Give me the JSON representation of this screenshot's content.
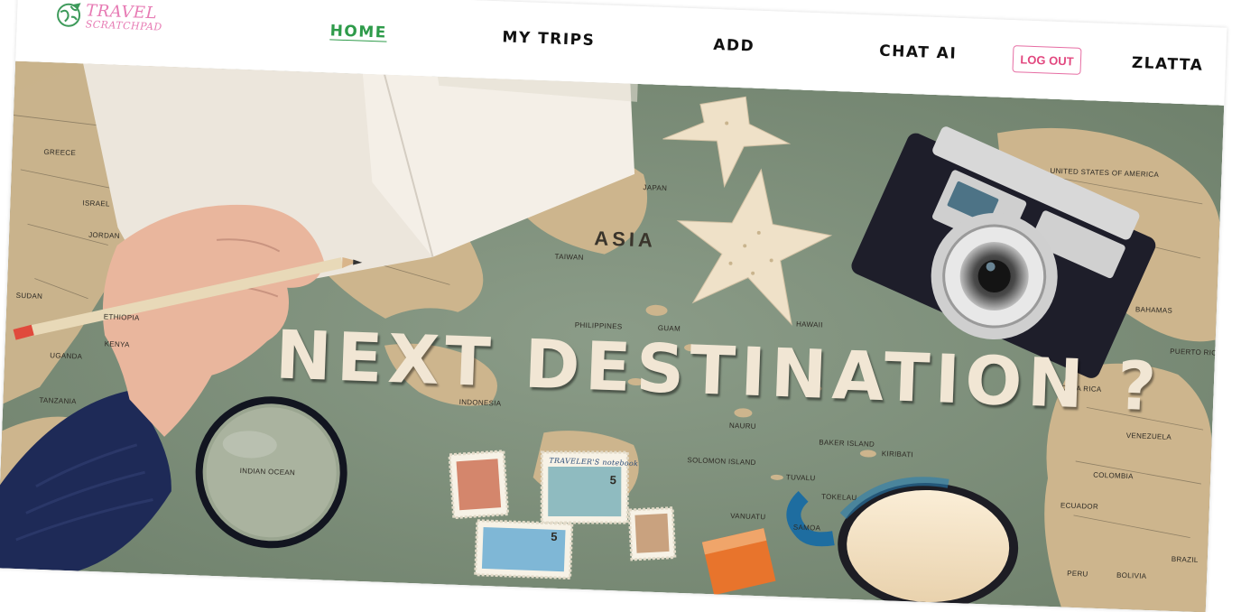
{
  "brand": {
    "logo_line1": "TRAVEL",
    "logo_line2": "SCRATCHPAD",
    "color": "#e77bb4"
  },
  "nav": {
    "items": [
      {
        "label": "HOME",
        "active": true
      },
      {
        "label": "MY TRIPS",
        "active": false
      },
      {
        "label": "ADD",
        "active": false
      },
      {
        "label": "CHAT AI",
        "active": false
      }
    ],
    "logout_label": "LOG OUT",
    "username": "ZLATTA",
    "active_color": "#2e9b4a",
    "logout_color": "#e2487f"
  },
  "hero": {
    "title": "NEXT DESTINATION ?",
    "map_labels": [
      "ASIA",
      "JAPAN",
      "TAIWAN",
      "PHILIPPINES",
      "GUAM",
      "HAWAII",
      "UNITED STATES OF AMERICA",
      "BAHAMAS",
      "PUERTO RICO",
      "INDONESIA",
      "SOLOMON ISLAND",
      "VANUATU",
      "SAMOA",
      "TOKELAU",
      "TUVALU",
      "NAURU",
      "BAKER ISLAND",
      "KIRIBATI",
      "VENEZUELA",
      "COLOMBIA",
      "ECUADOR",
      "PERU",
      "BRAZIL",
      "BOLIVIA",
      "GREECE",
      "ISRAEL",
      "JORDAN",
      "SUDAN",
      "KENYA",
      "UGANDA",
      "TANZANIA",
      "ETHIOPIA",
      "INDIAN OCEAN",
      "COSTA RICA"
    ],
    "stamp_labels": [
      "TRAVELER'S notebook",
      "5",
      "5"
    ]
  }
}
